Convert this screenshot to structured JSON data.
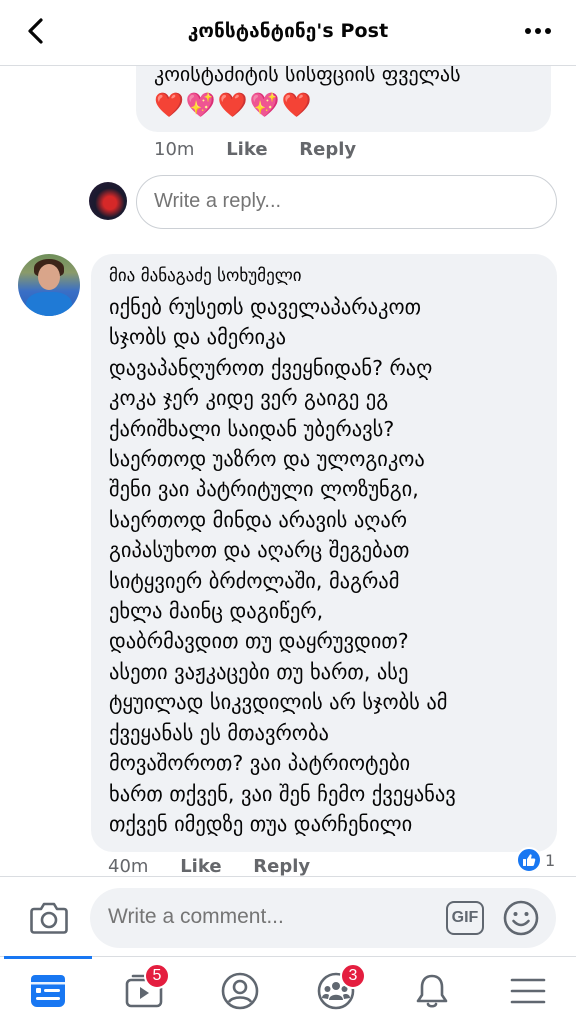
{
  "header": {
    "title": "კონსტანტინე's Post"
  },
  "comment1": {
    "text_partial": "კოისტაძიტის სისფციის ფველას",
    "hearts": "❤️💖❤️💖❤️",
    "time": "10m",
    "like_label": "Like",
    "reply_label": "Reply"
  },
  "reply_box": {
    "placeholder": "Write a reply..."
  },
  "comment2": {
    "author": "მია მანაგაძე სოხუმელი",
    "lines": [
      "იქნებ რუსეთს დაველაპარაკოთ",
      "სჯობს და ამერიკა",
      "დავაპანღუროთ ქვეყნიდან? რაღ",
      "კოკა ჯერ კიდე ვერ გაიგე ეგ",
      "ქარიშხალი საიდან უბერავს?",
      "საერთოდ უაზრო და ულოგიკოა",
      "შენი ვაი პატრიტული ლოზუნგი,",
      "საერთოდ მინდა არავის აღარ",
      "გიპასუხოთ და აღარც შეგებათ",
      "სიტყვიერ ბრძოლაში, მაგრამ",
      "ეხლა მაინც დაგიწერ,",
      "დაბრმავდით თუ დაყრუვდით?",
      "ასეთი ვაჟკაცები თუ ხართ, ასე",
      "ტყუილად სიკვდილის  არ სჯობს ამ",
      "ქვეყანას ეს მთავრობა",
      "მოვაშოროთ? ვაი პატრიოტები",
      "ხართ თქვენ, ვაი შენ ჩემო ქვეყანავ",
      "თქვენ იმედზე თუა დარჩენილი"
    ],
    "time": "40m",
    "like_label": "Like",
    "reply_label": "Reply",
    "reaction_count": "1"
  },
  "comment_bar": {
    "placeholder": "Write a comment...",
    "gif_label": "GIF"
  },
  "bottom_nav": {
    "items": [
      {
        "name": "news-feed",
        "badge": ""
      },
      {
        "name": "watch",
        "badge": "5"
      },
      {
        "name": "profile",
        "badge": ""
      },
      {
        "name": "groups",
        "badge": "3"
      },
      {
        "name": "notifications",
        "badge": ""
      },
      {
        "name": "menu",
        "badge": ""
      }
    ]
  },
  "colors": {
    "accent": "#1877f2",
    "badge": "#e41e3f",
    "bubble": "#f0f2f5",
    "meta": "#65676b"
  }
}
